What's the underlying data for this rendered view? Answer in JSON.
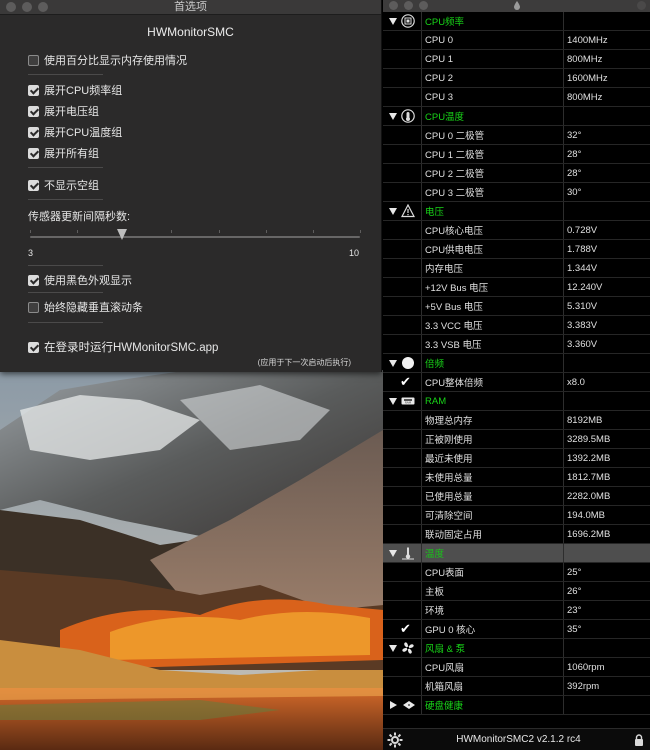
{
  "prefs": {
    "window_title": "首选项",
    "app_title": "HWMonitorSMC",
    "options": {
      "percent_memory": "使用百分比显示内存使用情况",
      "expand_cpu_freq": "展开CPU频率组",
      "expand_voltage": "展开电压组",
      "expand_cpu_temp": "展开CPU温度组",
      "expand_all": "展开所有组",
      "hide_empty": "不显示空组",
      "dark_appearance": "使用黑色外观显示",
      "hide_scroll": "始终隐藏垂直滚动条",
      "run_at_login": "在登录时运行HWMonitorSMC.app"
    },
    "checked": {
      "percent_memory": false,
      "expand_cpu_freq": true,
      "expand_voltage": true,
      "expand_cpu_temp": true,
      "expand_all": true,
      "hide_empty": true,
      "dark_appearance": true,
      "hide_scroll": false,
      "run_at_login": true
    },
    "interval_label": "传感器更新间隔秒数:",
    "slider_min": "3",
    "slider_max": "10",
    "slider_value": 0.28,
    "restart_note": "(应用于下一次启动后执行)"
  },
  "sensors": {
    "groups": [
      {
        "title": "CPU频率",
        "icon": "cpu-chip-icon",
        "rows": [
          {
            "label": "CPU 0",
            "value": "1400MHz"
          },
          {
            "label": "CPU 1",
            "value": "800MHz"
          },
          {
            "label": "CPU 2",
            "value": "1600MHz"
          },
          {
            "label": "CPU 3",
            "value": "800MHz"
          }
        ]
      },
      {
        "title": "CPU温度",
        "icon": "thermometer-chip-icon",
        "rows": [
          {
            "label": "CPU 0 二极管",
            "value": "32°"
          },
          {
            "label": "CPU 1 二极管",
            "value": "28°"
          },
          {
            "label": "CPU 2 二极管",
            "value": "28°"
          },
          {
            "label": "CPU 3 二极管",
            "value": "30°"
          }
        ]
      },
      {
        "title": "电压",
        "icon": "warning-triangle-icon",
        "rows": [
          {
            "label": "CPU核心电压",
            "value": "0.728V"
          },
          {
            "label": "CPU供电电压",
            "value": "1.788V"
          },
          {
            "label": "内存电压",
            "value": "1.344V"
          },
          {
            "label": "+12V Bus 电压",
            "value": "12.240V"
          },
          {
            "label": "+5V Bus 电压",
            "value": "5.310V"
          },
          {
            "label": "3.3 VCC 电压",
            "value": "3.383V"
          },
          {
            "label": "3.3 VSB 电压",
            "value": "3.360V"
          }
        ]
      },
      {
        "title": "倍频",
        "icon": "circle-icon",
        "rows": [
          {
            "label": "CPU整体倍频",
            "value": "x8.0",
            "checked": true
          }
        ]
      },
      {
        "title": "RAM",
        "icon": "ram-icon",
        "rows": [
          {
            "label": "物理总内存",
            "value": "8192MB"
          },
          {
            "label": "正被刚使用",
            "value": "3289.5MB"
          },
          {
            "label": "最近未使用",
            "value": "1392.2MB"
          },
          {
            "label": "未使用总量",
            "value": "1812.7MB"
          },
          {
            "label": "已使用总量",
            "value": "2282.0MB"
          },
          {
            "label": "可清除空间",
            "value": "194.0MB"
          },
          {
            "label": "联动固定占用",
            "value": "1696.2MB"
          }
        ]
      },
      {
        "title": "温度",
        "icon": "temperature-icon",
        "selected": true,
        "rows": [
          {
            "label": "CPU表面",
            "value": "25°"
          },
          {
            "label": "主板",
            "value": "26°"
          },
          {
            "label": "环境",
            "value": "23°"
          },
          {
            "label": "GPU 0 核心",
            "value": "35°",
            "checked": true
          }
        ]
      },
      {
        "title": "风扇 & 泵",
        "icon": "fan-icon",
        "rows": [
          {
            "label": "CPU风扇",
            "value": "1060rpm"
          },
          {
            "label": "机箱风扇",
            "value": "392rpm"
          }
        ]
      },
      {
        "title": "硬盘健康",
        "icon": "disk-icon",
        "collapsed": true,
        "rows": []
      }
    ],
    "footer_version": "HWMonitorSMC2 v2.1.2 rc4"
  },
  "colors": {
    "group_title": "#18d418",
    "window_bg": "#2b2a2a",
    "list_bg": "#000000"
  }
}
